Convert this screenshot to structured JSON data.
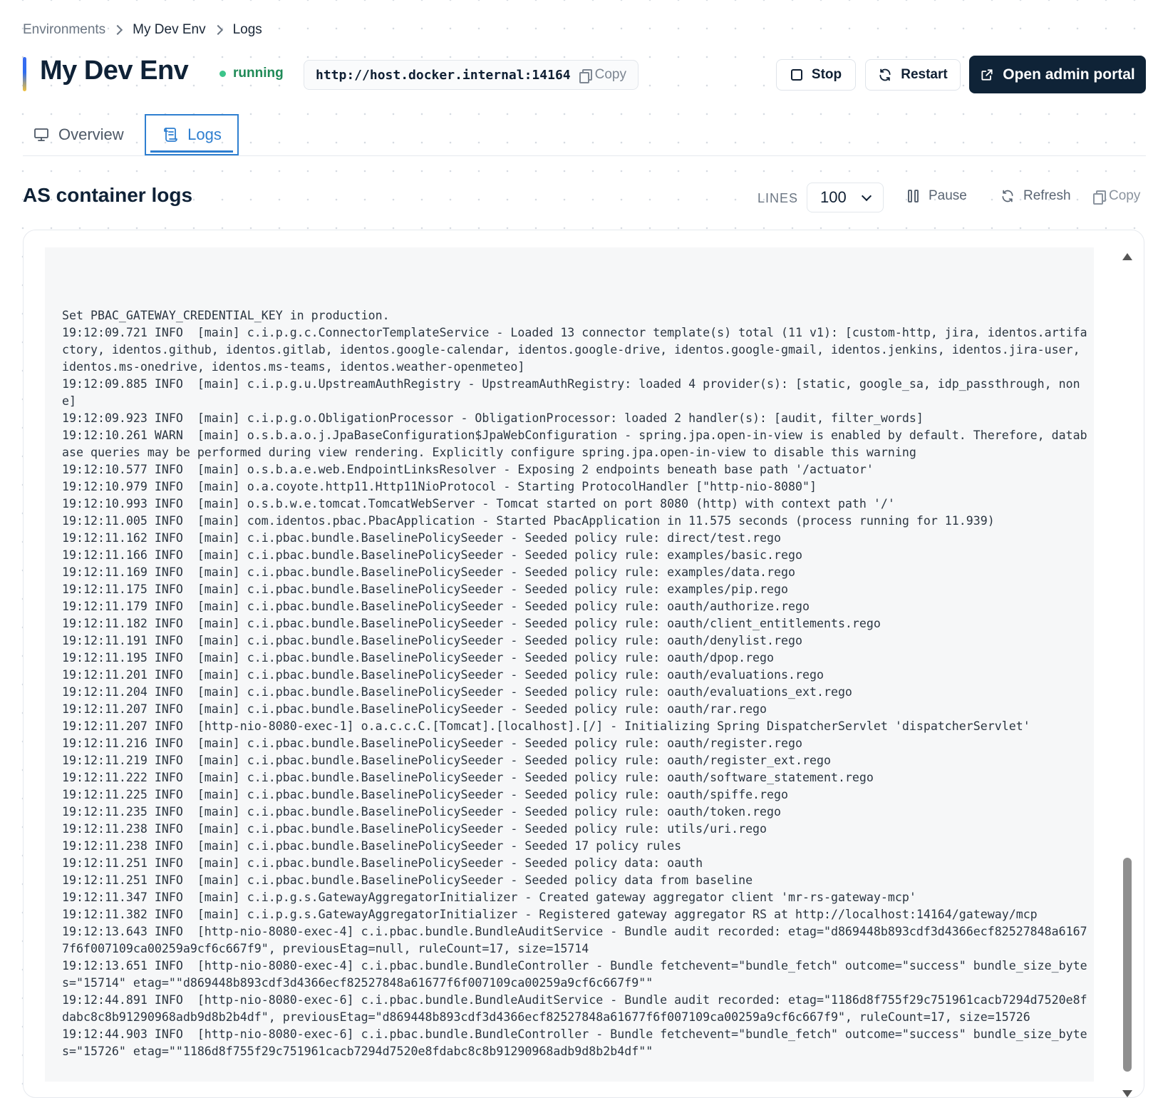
{
  "breadcrumb": [
    "Environments",
    "My Dev Env",
    "Logs"
  ],
  "header": {
    "title": "My Dev Env",
    "status": "running",
    "url": "http://host.docker.internal:14164",
    "copy_label": "Copy",
    "stop_label": "Stop",
    "restart_label": "Restart",
    "admin_label": "Open admin portal"
  },
  "tabs": [
    {
      "label": "Overview",
      "icon": "monitor-icon",
      "active": false
    },
    {
      "label": "Logs",
      "icon": "scroll-icon",
      "active": true
    }
  ],
  "logs": {
    "title": "AS container logs",
    "lines_label": "LINES",
    "lines_value": "100",
    "pause_label": "Pause",
    "refresh_label": "Refresh",
    "copy_label": "Copy",
    "text": "Set PBAC_GATEWAY_CREDENTIAL_KEY in production.\n19:12:09.721 INFO  [main] c.i.p.g.c.ConnectorTemplateService - Loaded 13 connector template(s) total (11 v1): [custom-http, jira, identos.artifactory, identos.github, identos.gitlab, identos.google-calendar, identos.google-drive, identos.google-gmail, identos.jenkins, identos.jira-user, identos.ms-onedrive, identos.ms-teams, identos.weather-openmeteo]\n19:12:09.885 INFO  [main] c.i.p.g.u.UpstreamAuthRegistry - UpstreamAuthRegistry: loaded 4 provider(s): [static, google_sa, idp_passthrough, none]\n19:12:09.923 INFO  [main] c.i.p.g.o.ObligationProcessor - ObligationProcessor: loaded 2 handler(s): [audit, filter_words]\n19:12:10.261 WARN  [main] o.s.b.a.o.j.JpaBaseConfiguration$JpaWebConfiguration - spring.jpa.open-in-view is enabled by default. Therefore, database queries may be performed during view rendering. Explicitly configure spring.jpa.open-in-view to disable this warning\n19:12:10.577 INFO  [main] o.s.b.a.e.web.EndpointLinksResolver - Exposing 2 endpoints beneath base path '/actuator'\n19:12:10.979 INFO  [main] o.a.coyote.http11.Http11NioProtocol - Starting ProtocolHandler [\"http-nio-8080\"]\n19:12:10.993 INFO  [main] o.s.b.w.e.tomcat.TomcatWebServer - Tomcat started on port 8080 (http) with context path '/'\n19:12:11.005 INFO  [main] com.identos.pbac.PbacApplication - Started PbacApplication in 11.575 seconds (process running for 11.939)\n19:12:11.162 INFO  [main] c.i.pbac.bundle.BaselinePolicySeeder - Seeded policy rule: direct/test.rego\n19:12:11.166 INFO  [main] c.i.pbac.bundle.BaselinePolicySeeder - Seeded policy rule: examples/basic.rego\n19:12:11.169 INFO  [main] c.i.pbac.bundle.BaselinePolicySeeder - Seeded policy rule: examples/data.rego\n19:12:11.175 INFO  [main] c.i.pbac.bundle.BaselinePolicySeeder - Seeded policy rule: examples/pip.rego\n19:12:11.179 INFO  [main] c.i.pbac.bundle.BaselinePolicySeeder - Seeded policy rule: oauth/authorize.rego\n19:12:11.182 INFO  [main] c.i.pbac.bundle.BaselinePolicySeeder - Seeded policy rule: oauth/client_entitlements.rego\n19:12:11.191 INFO  [main] c.i.pbac.bundle.BaselinePolicySeeder - Seeded policy rule: oauth/denylist.rego\n19:12:11.195 INFO  [main] c.i.pbac.bundle.BaselinePolicySeeder - Seeded policy rule: oauth/dpop.rego\n19:12:11.201 INFO  [main] c.i.pbac.bundle.BaselinePolicySeeder - Seeded policy rule: oauth/evaluations.rego\n19:12:11.204 INFO  [main] c.i.pbac.bundle.BaselinePolicySeeder - Seeded policy rule: oauth/evaluations_ext.rego\n19:12:11.207 INFO  [main] c.i.pbac.bundle.BaselinePolicySeeder - Seeded policy rule: oauth/rar.rego\n19:12:11.207 INFO  [http-nio-8080-exec-1] o.a.c.c.C.[Tomcat].[localhost].[/] - Initializing Spring DispatcherServlet 'dispatcherServlet'\n19:12:11.216 INFO  [main] c.i.pbac.bundle.BaselinePolicySeeder - Seeded policy rule: oauth/register.rego\n19:12:11.219 INFO  [main] c.i.pbac.bundle.BaselinePolicySeeder - Seeded policy rule: oauth/register_ext.rego\n19:12:11.222 INFO  [main] c.i.pbac.bundle.BaselinePolicySeeder - Seeded policy rule: oauth/software_statement.rego\n19:12:11.225 INFO  [main] c.i.pbac.bundle.BaselinePolicySeeder - Seeded policy rule: oauth/spiffe.rego\n19:12:11.235 INFO  [main] c.i.pbac.bundle.BaselinePolicySeeder - Seeded policy rule: oauth/token.rego\n19:12:11.238 INFO  [main] c.i.pbac.bundle.BaselinePolicySeeder - Seeded policy rule: utils/uri.rego\n19:12:11.238 INFO  [main] c.i.pbac.bundle.BaselinePolicySeeder - Seeded 17 policy rules\n19:12:11.251 INFO  [main] c.i.pbac.bundle.BaselinePolicySeeder - Seeded policy data: oauth\n19:12:11.251 INFO  [main] c.i.pbac.bundle.BaselinePolicySeeder - Seeded policy data from baseline\n19:12:11.347 INFO  [main] c.i.p.g.s.GatewayAggregatorInitializer - Created gateway aggregator client 'mr-rs-gateway-mcp'\n19:12:11.382 INFO  [main] c.i.p.g.s.GatewayAggregatorInitializer - Registered gateway aggregator RS at http://localhost:14164/gateway/mcp\n19:12:13.643 INFO  [http-nio-8080-exec-4] c.i.pbac.bundle.BundleAuditService - Bundle audit recorded: etag=\"d869448b893cdf3d4366ecf82527848a61677f6f007109ca00259a9cf6c667f9\", previousEtag=null, ruleCount=17, size=15714\n19:12:13.651 INFO  [http-nio-8080-exec-4] c.i.pbac.bundle.BundleController - Bundle fetchevent=\"bundle_fetch\" outcome=\"success\" bundle_size_bytes=\"15714\" etag=\"\"d869448b893cdf3d4366ecf82527848a61677f6f007109ca00259a9cf6c667f9\"\"\n19:12:44.891 INFO  [http-nio-8080-exec-6] c.i.pbac.bundle.BundleAuditService - Bundle audit recorded: etag=\"1186d8f755f29c751961cacb7294d7520e8fdabc8c8b91290968adb9d8b2b4df\", previousEtag=\"d869448b893cdf3d4366ecf82527848a61677f6f007109ca00259a9cf6c667f9\", ruleCount=17, size=15726\n19:12:44.903 INFO  [http-nio-8080-exec-6] c.i.pbac.bundle.BundleController - Bundle fetchevent=\"bundle_fetch\" outcome=\"success\" bundle_size_bytes=\"15726\" etag=\"\"1186d8f755f29c751961cacb7294d7520e8fdabc8c8b91290968adb9d8b2b4df\"\""
  },
  "colors": {
    "primary": "#0f2337",
    "accent_blue": "#2f7fd0",
    "status_green": "#3cc48a"
  }
}
